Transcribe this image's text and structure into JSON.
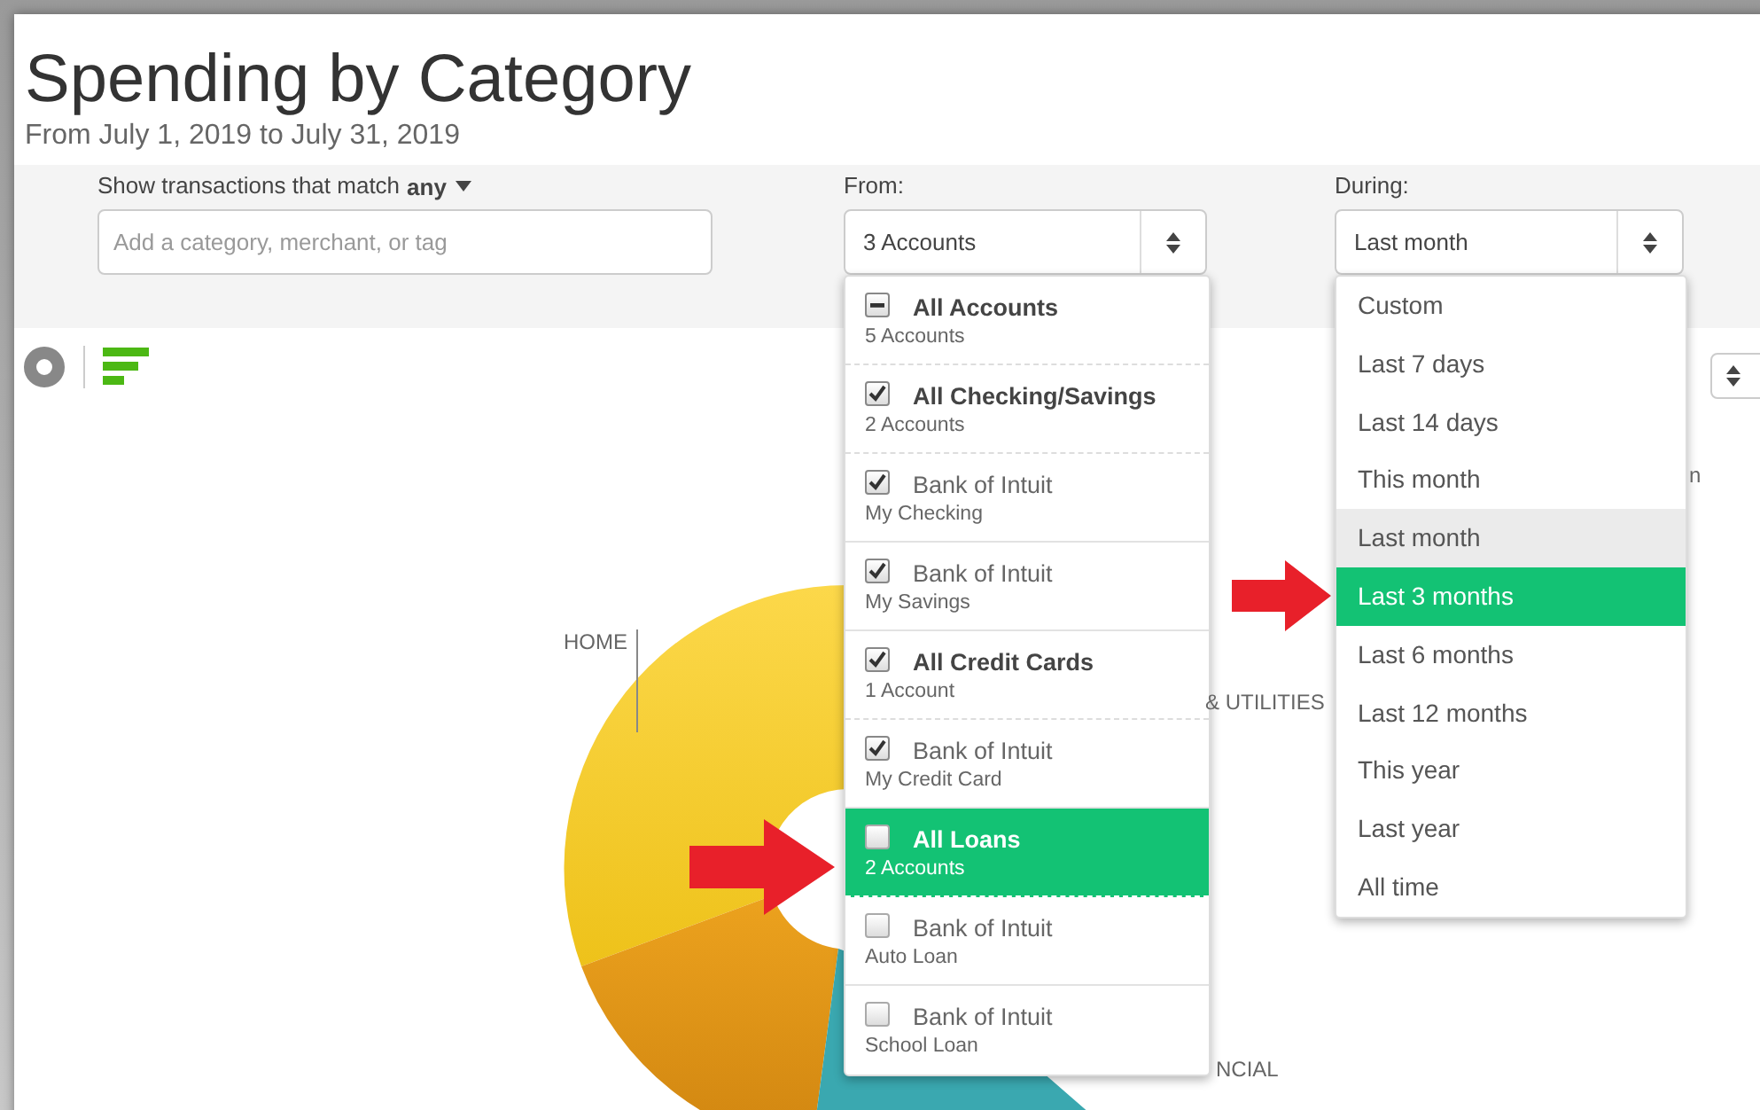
{
  "page": {
    "title": "Spending by Category",
    "subtitle": "From July 1, 2019 to July 31, 2019"
  },
  "filters": {
    "match_label": "Show transactions that match",
    "match_mode": "any",
    "search": {
      "placeholder": "Add a category, merchant, or tag"
    },
    "from": {
      "label": "From:",
      "value": "3 Accounts",
      "open": true
    },
    "during": {
      "label": "During:",
      "value": "Last month",
      "open": true
    }
  },
  "accounts_menu": [
    {
      "kind": "group",
      "name": "All Accounts",
      "detail": "5 Accounts",
      "checked": true,
      "partial": true,
      "highlighted": false
    },
    {
      "kind": "group",
      "name": "All Checking/Savings",
      "detail": "2 Accounts",
      "checked": true,
      "partial": false,
      "highlighted": false
    },
    {
      "kind": "account",
      "name": "Bank of Intuit",
      "detail": "My Checking",
      "checked": true,
      "partial": false,
      "highlighted": false
    },
    {
      "kind": "account",
      "name": "Bank of Intuit",
      "detail": "My Savings",
      "checked": true,
      "partial": false,
      "highlighted": false
    },
    {
      "kind": "group",
      "name": "All Credit Cards",
      "detail": "1 Account",
      "checked": true,
      "partial": false,
      "highlighted": false
    },
    {
      "kind": "account",
      "name": "Bank of Intuit",
      "detail": "My Credit Card",
      "checked": true,
      "partial": false,
      "highlighted": false
    },
    {
      "kind": "group",
      "name": "All Loans",
      "detail": "2 Accounts",
      "checked": false,
      "partial": false,
      "highlighted": true
    },
    {
      "kind": "account",
      "name": "Bank of Intuit",
      "detail": "Auto Loan",
      "checked": false,
      "partial": false,
      "highlighted": false
    },
    {
      "kind": "account",
      "name": "Bank of Intuit",
      "detail": "School Loan",
      "checked": false,
      "partial": false,
      "highlighted": false
    }
  ],
  "period_menu": [
    {
      "label": "Custom",
      "selected": false,
      "highlighted": false
    },
    {
      "label": "Last 7 days",
      "selected": false,
      "highlighted": false
    },
    {
      "label": "Last 14 days",
      "selected": false,
      "highlighted": false
    },
    {
      "label": "This month",
      "selected": false,
      "highlighted": false
    },
    {
      "label": "Last month",
      "selected": true,
      "highlighted": false
    },
    {
      "label": "Last 3 months",
      "selected": false,
      "highlighted": true
    },
    {
      "label": "Last 6 months",
      "selected": false,
      "highlighted": false
    },
    {
      "label": "Last 12 months",
      "selected": false,
      "highlighted": false
    },
    {
      "label": "This year",
      "selected": false,
      "highlighted": false
    },
    {
      "label": "Last year",
      "selected": false,
      "highlighted": false
    },
    {
      "label": "All time",
      "selected": false,
      "highlighted": false
    }
  ],
  "view_toggle": [
    {
      "kind": "donut",
      "selected": false
    },
    {
      "kind": "bars",
      "selected": true
    }
  ],
  "chart": {
    "labels": [
      "HOME",
      "& UTILITIES",
      "NCIAL",
      "n"
    ]
  }
}
